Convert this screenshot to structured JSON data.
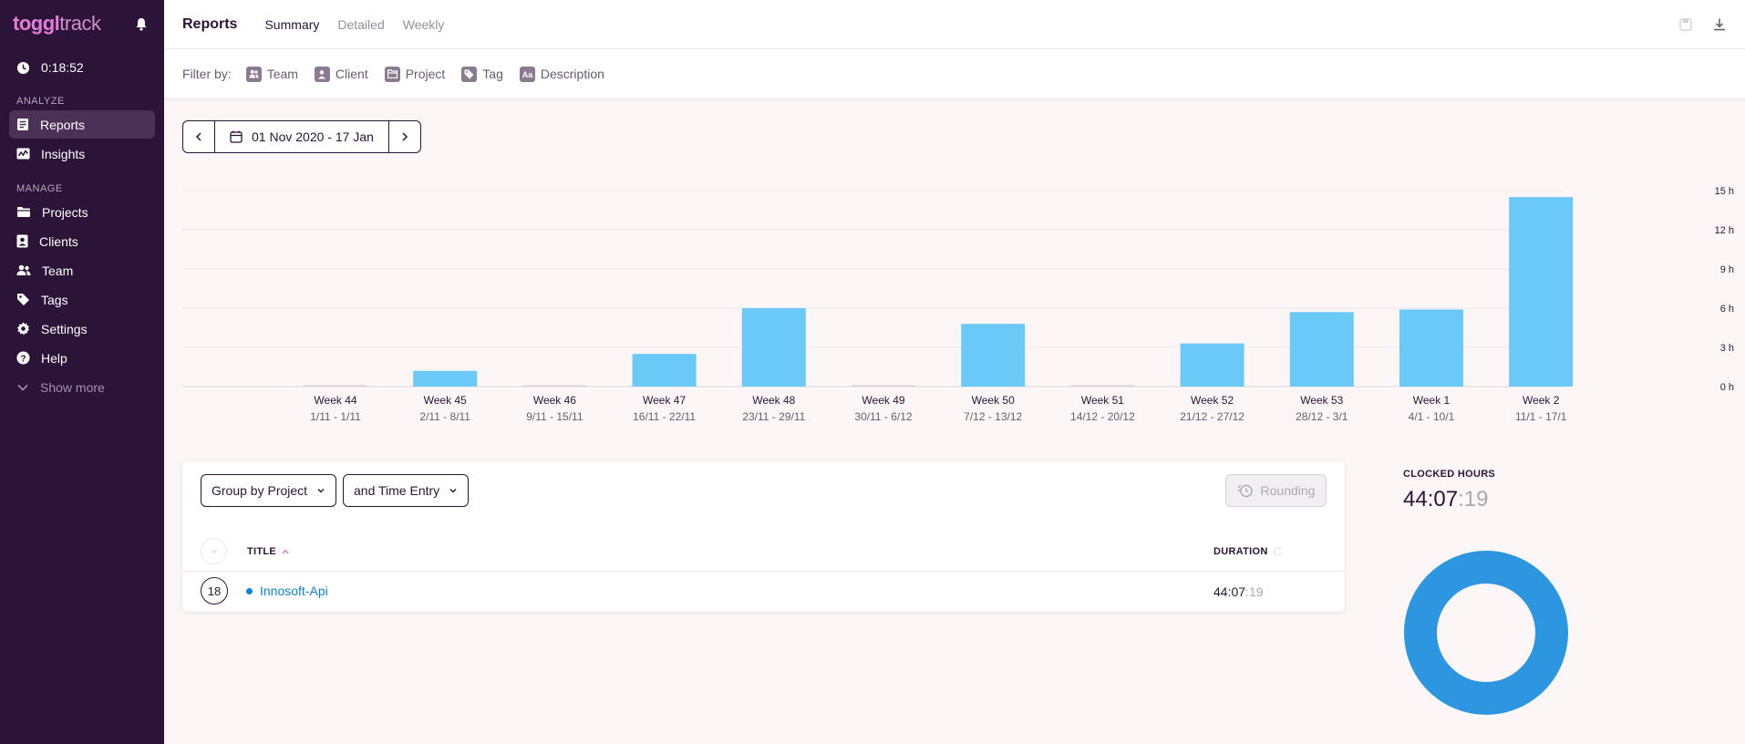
{
  "sidebar": {
    "logo_bold": "toggl",
    "logo_light": "track",
    "timer": "0:18:52",
    "analyze_label": "ANALYZE",
    "manage_label": "MANAGE",
    "items": [
      {
        "label": "Reports",
        "icon": "reports-icon"
      },
      {
        "label": "Insights",
        "icon": "insights-icon"
      },
      {
        "label": "Projects",
        "icon": "folder-icon"
      },
      {
        "label": "Clients",
        "icon": "client-icon"
      },
      {
        "label": "Team",
        "icon": "team-icon"
      },
      {
        "label": "Tags",
        "icon": "tag-icon"
      },
      {
        "label": "Settings",
        "icon": "gear-icon"
      },
      {
        "label": "Help",
        "icon": "help-icon"
      },
      {
        "label": "Show more",
        "icon": "chevron-down-icon"
      }
    ]
  },
  "header": {
    "title": "Reports",
    "tabs": [
      "Summary",
      "Detailed",
      "Weekly"
    ],
    "active_tab": "Summary"
  },
  "filters": {
    "label": "Filter by:",
    "items": [
      "Team",
      "Client",
      "Project",
      "Tag",
      "Description"
    ]
  },
  "date_range": "01 Nov 2020 - 17 Jan",
  "chart_data": {
    "type": "bar",
    "categories": [
      "Week 44",
      "Week 45",
      "Week 46",
      "Week 47",
      "Week 48",
      "Week 49",
      "Week 50",
      "Week 51",
      "Week 52",
      "Week 53",
      "Week 1",
      "Week 2"
    ],
    "sublabels": [
      "1/11 - 1/11",
      "2/11 - 8/11",
      "9/11 - 15/11",
      "16/11 - 22/11",
      "23/11 - 29/11",
      "30/11 - 6/12",
      "7/12 - 13/12",
      "14/12 - 20/12",
      "21/12 - 27/12",
      "28/12 - 3/1",
      "4/1 - 10/1",
      "11/1 - 17/1"
    ],
    "values": [
      0,
      1.2,
      0,
      2.5,
      6.0,
      0,
      4.8,
      0,
      3.3,
      5.7,
      5.9,
      14.5
    ],
    "yticks": [
      "0 h",
      "3 h",
      "6 h",
      "9 h",
      "12 h",
      "15 h"
    ],
    "ylim": [
      0,
      15
    ],
    "color": "#6ac9f7"
  },
  "table": {
    "group_by": "Group by Project",
    "sub_group": "and Time Entry",
    "rounding": "Rounding",
    "col_title": "TITLE",
    "col_duration": "DURATION",
    "rows": [
      {
        "count": "18",
        "project": "Innosoft-Api",
        "duration_main": "44:07",
        "duration_sec": ":19"
      }
    ]
  },
  "clocked": {
    "label": "CLOCKED HOURS",
    "main": "44:07",
    "sec": ":19",
    "color": "#2d96e0"
  }
}
